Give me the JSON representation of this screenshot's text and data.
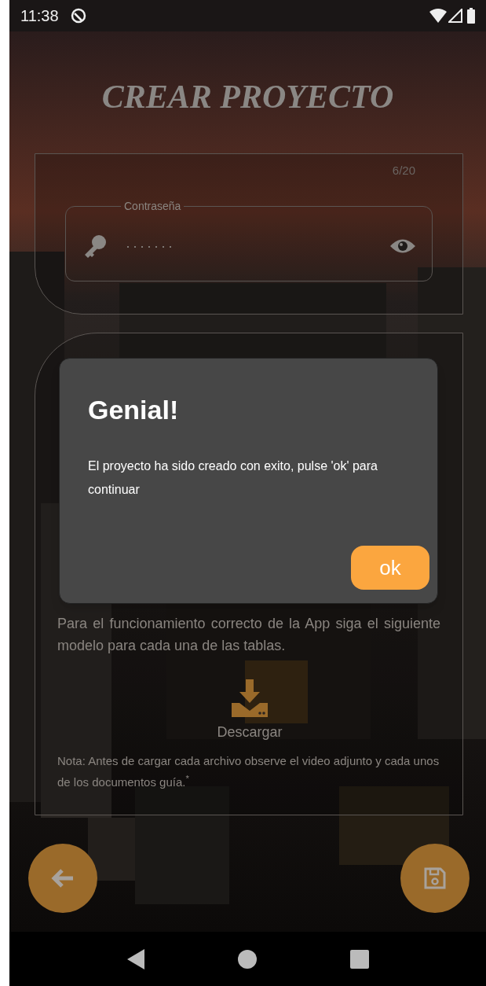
{
  "status_bar": {
    "time": "11:38"
  },
  "title": "CREAR PROYECTO",
  "form": {
    "counter": "6/20",
    "password_field": {
      "label": "Contraseña",
      "value": "·······"
    }
  },
  "instructions": {
    "paragraph": "Para el funcionamiento correcto de la App siga el siguiente modelo para cada una de las tablas.",
    "download_label": "Descargar",
    "note": "Nota: Antes de cargar cada archivo observe el video adjunto y cada unos de los documentos guía.$^{*}$"
  },
  "dialog": {
    "title": "Genial!",
    "message": "El proyecto ha sido creado con exito, pulse 'ok' para continuar",
    "button": "ok"
  }
}
